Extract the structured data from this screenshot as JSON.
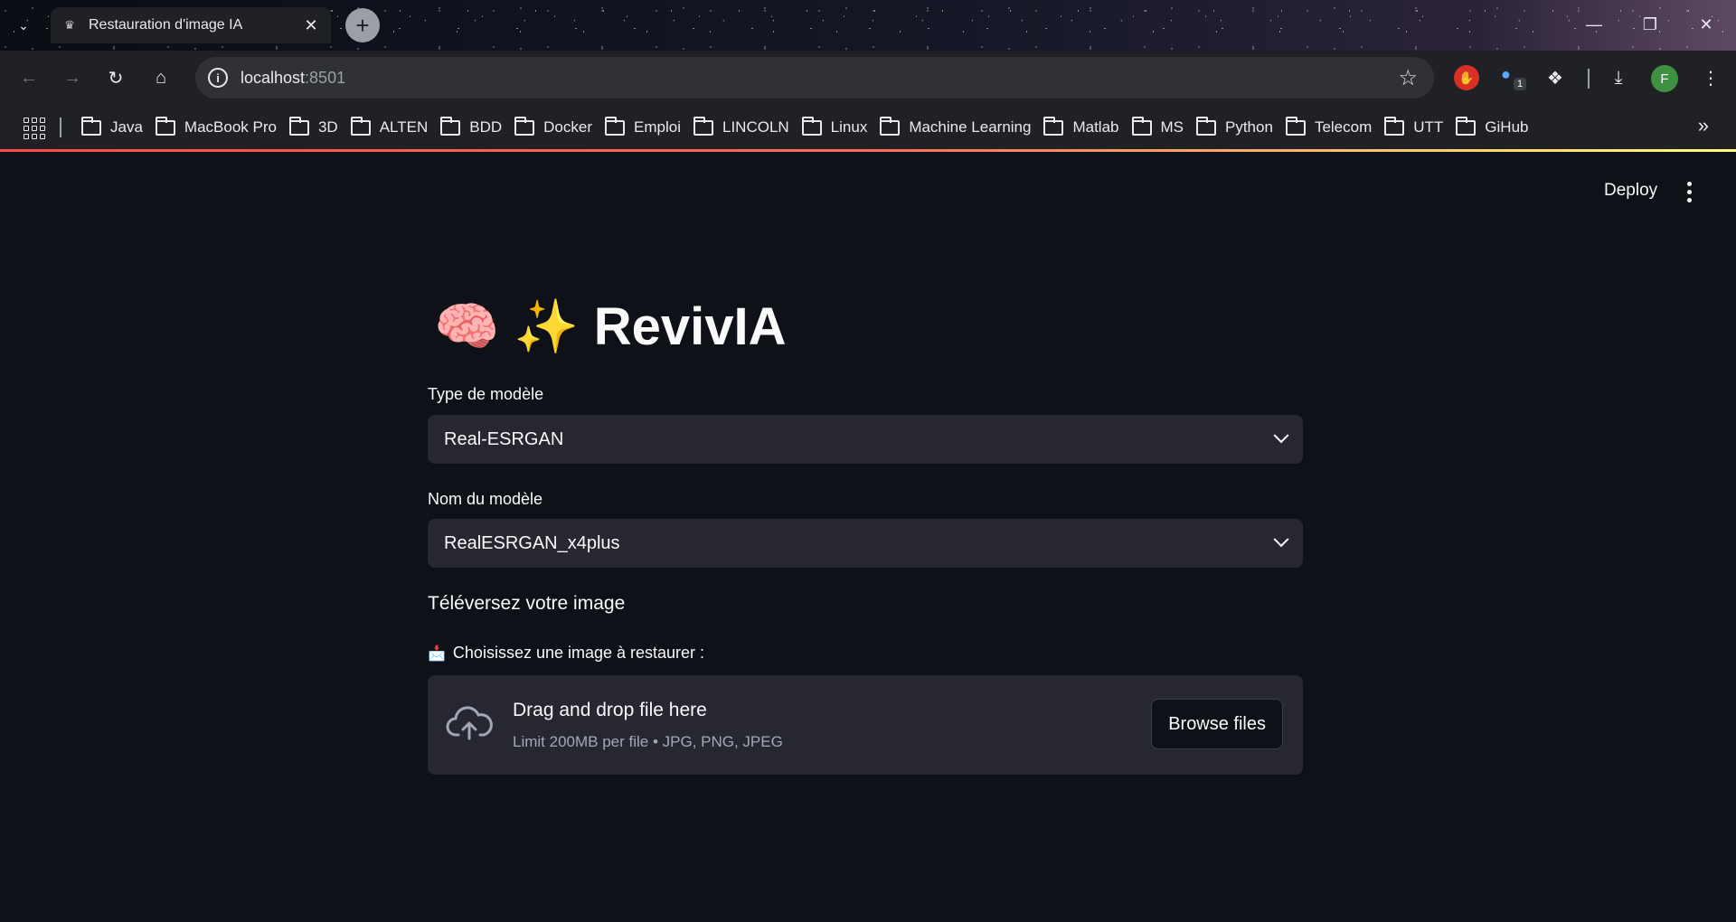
{
  "browser": {
    "tab": {
      "title": "Restauration d'image IA",
      "favicon": "crown-icon"
    },
    "address": {
      "host": "localhost",
      "port": ":8501"
    },
    "bookmarks": [
      "Java",
      "MacBook Pro",
      "3D",
      "ALTEN",
      "BDD",
      "Docker",
      "Emploi",
      "LINCOLN",
      "Linux",
      "Machine Learning",
      "Matlab",
      "MS",
      "Python",
      "Telecom",
      "UTT",
      "GiHub"
    ],
    "extension_badge_count": "1",
    "profile_initial": "F"
  },
  "app": {
    "deploy_label": "Deploy",
    "title_emoji": "🧠 ✨",
    "title_text": "RevivIA",
    "model_type": {
      "label": "Type de modèle",
      "value": "Real-ESRGAN"
    },
    "model_name": {
      "label": "Nom du modèle",
      "value": "RealESRGAN_x4plus"
    },
    "upload_header": "Téléversez votre image",
    "upload_label": "Choisissez une image à restaurer :",
    "dropzone": {
      "title": "Drag and drop file here",
      "limit": "Limit 200MB per file • JPG, PNG, JPEG",
      "browse_label": "Browse files"
    }
  },
  "colors": {
    "app_bg": "#0e1117",
    "widget_bg": "#262730",
    "accent_start": "#ff4b4b",
    "accent_end": "#fffd80"
  }
}
